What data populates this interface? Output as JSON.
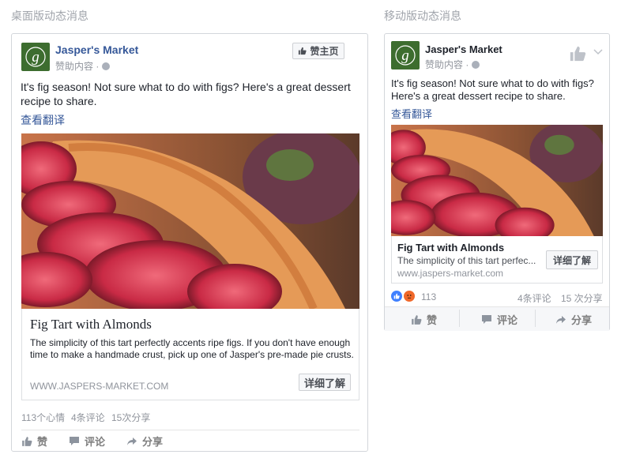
{
  "labels": {
    "desktop": "桌面版动态消息",
    "mobile": "移动版动态消息"
  },
  "post": {
    "page_name": "Jasper's Market",
    "sponsored": "赞助内容 ·",
    "like_page_label": "赞主页",
    "text": "It's fig season! Not sure what to do with figs? Here's a great dessert recipe to share.",
    "see_translation": "查看翻译"
  },
  "ad": {
    "title": "Fig Tart with Almonds",
    "description_full": "The simplicity of this tart perfectly accents ripe figs. If you don't have enough time to make a handmade crust, pick up one of Jasper's pre-made pie crusts.",
    "description_short": "The simplicity of this tart perfec...",
    "url_desktop": "WWW.JASPERS-MARKET.COM",
    "url_mobile": "www.jaspers-market.com",
    "cta": "详细了解"
  },
  "desktop_stats": {
    "reactions": "113个心情",
    "comments": "4条评论",
    "shares": "15次分享"
  },
  "mobile_stats": {
    "reactions_count": "113",
    "comments": "4条评论",
    "shares": "15 次分享"
  },
  "actions": {
    "like": "赞",
    "comment": "评论",
    "share": "分享"
  },
  "icons": [
    "thumbs-up-icon",
    "comment-icon",
    "share-icon",
    "globe-icon",
    "chevron-down-icon",
    "like-reaction-icon",
    "angry-reaction-icon"
  ],
  "colors": {
    "brand_blue": "#365899",
    "logo_green": "#3d6d2f",
    "muted": "#90949c"
  }
}
